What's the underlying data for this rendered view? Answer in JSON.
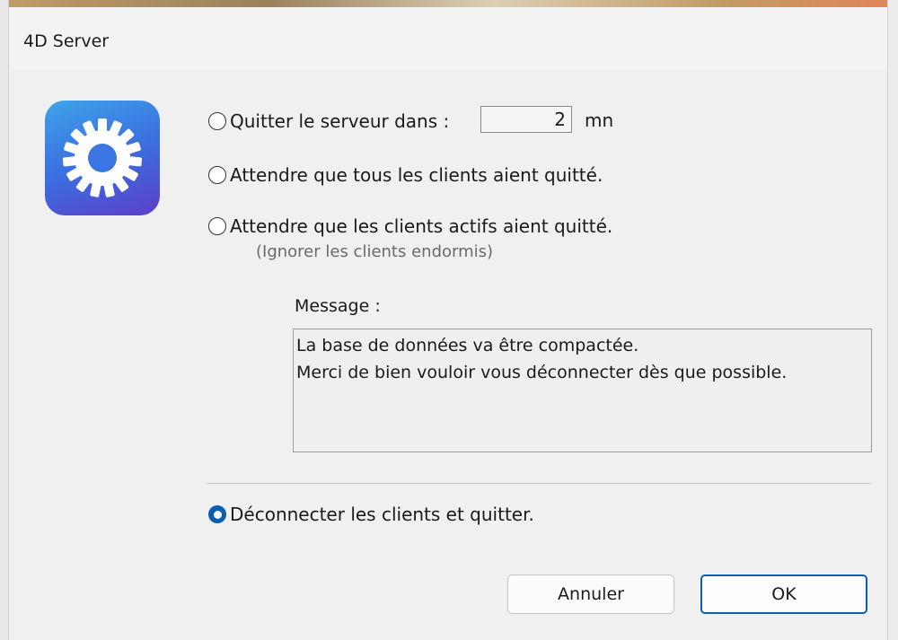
{
  "window": {
    "title": "4D Server"
  },
  "app_icon": {
    "name": "gear-icon",
    "colors": {
      "start": "#3fa3ea",
      "mid": "#3b6fe0",
      "end": "#5b3fc9"
    }
  },
  "options": {
    "quit_in": {
      "label": "Quitter le serveur dans :",
      "minutes_value": "2",
      "unit": "mn",
      "selected": false
    },
    "wait_all": {
      "label": "Attendre que tous les clients aient quitté.",
      "selected": false
    },
    "wait_active": {
      "label": "Attendre que les clients actifs aient quitté.",
      "hint": "(Ignorer les clients endormis)",
      "selected": false
    },
    "disconnect": {
      "label": "Déconnecter les clients et quitter.",
      "selected": true
    }
  },
  "message": {
    "label": "Message :",
    "text": "La base de données va être compactée.\nMerci de bien vouloir vous déconnecter dès que possible."
  },
  "buttons": {
    "cancel": "Annuler",
    "ok": "OK"
  },
  "colors": {
    "accent": "#0a5fb4"
  }
}
